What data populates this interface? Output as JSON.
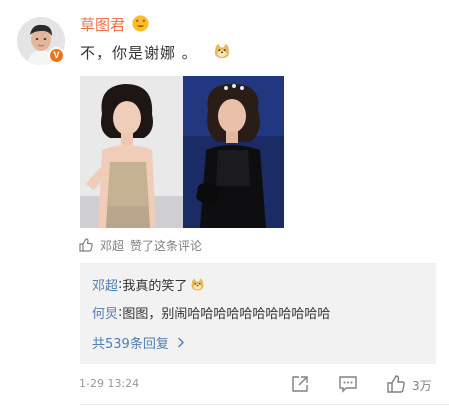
{
  "comment": {
    "username": "草图君",
    "username_emoji": "heart-eyes-emoji",
    "text": "不，你是谢娜 。",
    "text_emoji": "doge-emoji",
    "verified_badge": "V",
    "accent_color": "#eb7350"
  },
  "likes": {
    "liker": "邓超",
    "label": "赞了这条评论"
  },
  "replies": {
    "items": [
      {
        "author": "邓超",
        "sep": ": ",
        "text": "我真的笑了",
        "emoji": "doge-emoji"
      },
      {
        "author": "何炅",
        "sep": ": ",
        "text": "图图，别闹哈哈哈哈哈哈哈哈哈哈哈"
      }
    ],
    "more_label": "共539条回复"
  },
  "footer": {
    "timestamp": "1-29 13:24",
    "like_count": "3万"
  },
  "colors": {
    "link": "#507daf",
    "muted": "#808080",
    "reply_bg": "#f2f2f2"
  }
}
